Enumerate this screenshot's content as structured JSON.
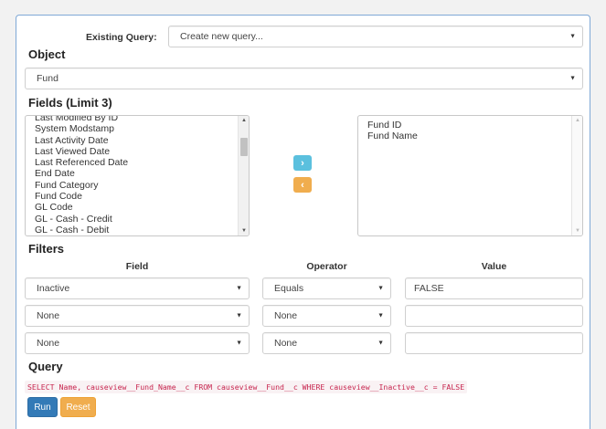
{
  "existing_query": {
    "label": "Existing Query:",
    "selected": "Create new query..."
  },
  "object": {
    "title": "Object",
    "selected": "Fund"
  },
  "fields": {
    "title": "Fields (Limit 3)",
    "available": [
      "Last Modified By ID",
      "System Modstamp",
      "Last Activity Date",
      "Last Viewed Date",
      "Last Referenced Date",
      "End Date",
      "Fund Category",
      "Fund Code",
      "GL Code",
      "GL - Cash - Credit",
      "GL - Cash - Debit"
    ],
    "selected": [
      "Fund ID",
      "Fund Name"
    ],
    "add_icon": "chevron-right-icon",
    "remove_icon": "chevron-left-icon"
  },
  "filters": {
    "title": "Filters",
    "headers": {
      "field": "Field",
      "operator": "Operator",
      "value": "Value"
    },
    "rows": [
      {
        "field": "Inactive",
        "operator": "Equals",
        "value": "FALSE"
      },
      {
        "field": "None",
        "operator": "None",
        "value": ""
      },
      {
        "field": "None",
        "operator": "None",
        "value": ""
      }
    ]
  },
  "query": {
    "title": "Query",
    "text": "SELECT Name, causeview__Fund_Name__c FROM causeview__Fund__c WHERE causeview__Inactive__c = FALSE",
    "run_label": "Run",
    "reset_label": "Reset"
  },
  "colors": {
    "primary": "#337ab7",
    "info": "#5bc0de",
    "warning": "#f0ad4e",
    "code": "#c7254e"
  }
}
